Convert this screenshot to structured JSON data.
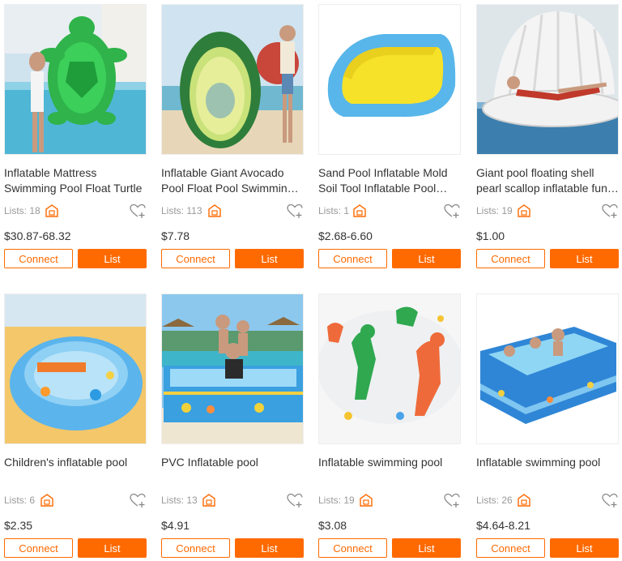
{
  "colors": {
    "accent": "#ff6a00",
    "muted": "#999999",
    "text": "#333333"
  },
  "products": [
    {
      "title": "Inflatable Mattress Swimming Pool Float Turtle",
      "lists_label": "Lists:",
      "lists_count": "18",
      "price": "$30.87-68.32",
      "connect_label": "Connect",
      "list_label": "List",
      "image": "turtle-float-photo"
    },
    {
      "title": "Inflatable Giant Avocado Pool Float Pool Swimming Ring",
      "lists_label": "Lists:",
      "lists_count": "113",
      "price": "$7.78",
      "connect_label": "Connect",
      "list_label": "List",
      "image": "avocado-float-photo"
    },
    {
      "title": "Sand Pool Inflatable Mold Soil Tool Inflatable Pool Tray",
      "lists_label": "Lists:",
      "lists_count": "1",
      "price": "$2.68-6.60",
      "connect_label": "Connect",
      "list_label": "List",
      "image": "sand-pool-photo"
    },
    {
      "title": "Giant pool floating shell pearl scallop inflatable fun float",
      "lists_label": "Lists:",
      "lists_count": "19",
      "price": "$1.00",
      "connect_label": "Connect",
      "list_label": "List",
      "image": "shell-float-photo"
    },
    {
      "title": "Children's inflatable pool",
      "lists_label": "Lists:",
      "lists_count": "6",
      "price": "$2.35",
      "connect_label": "Connect",
      "list_label": "List",
      "image": "round-kids-pool-photo"
    },
    {
      "title": "PVC Inflatable pool",
      "lists_label": "Lists:",
      "lists_count": "13",
      "price": "$4.91",
      "connect_label": "Connect",
      "list_label": "List",
      "image": "family-pool-photo"
    },
    {
      "title": "Inflatable swimming pool",
      "lists_label": "Lists:",
      "lists_count": "19",
      "price": "$3.08",
      "connect_label": "Connect",
      "list_label": "List",
      "image": "dinosaur-pool-photo"
    },
    {
      "title": "Inflatable swimming pool",
      "lists_label": "Lists:",
      "lists_count": "26",
      "price": "$4.64-8.21",
      "connect_label": "Connect",
      "list_label": "List",
      "image": "rectangular-pool-photo"
    }
  ]
}
